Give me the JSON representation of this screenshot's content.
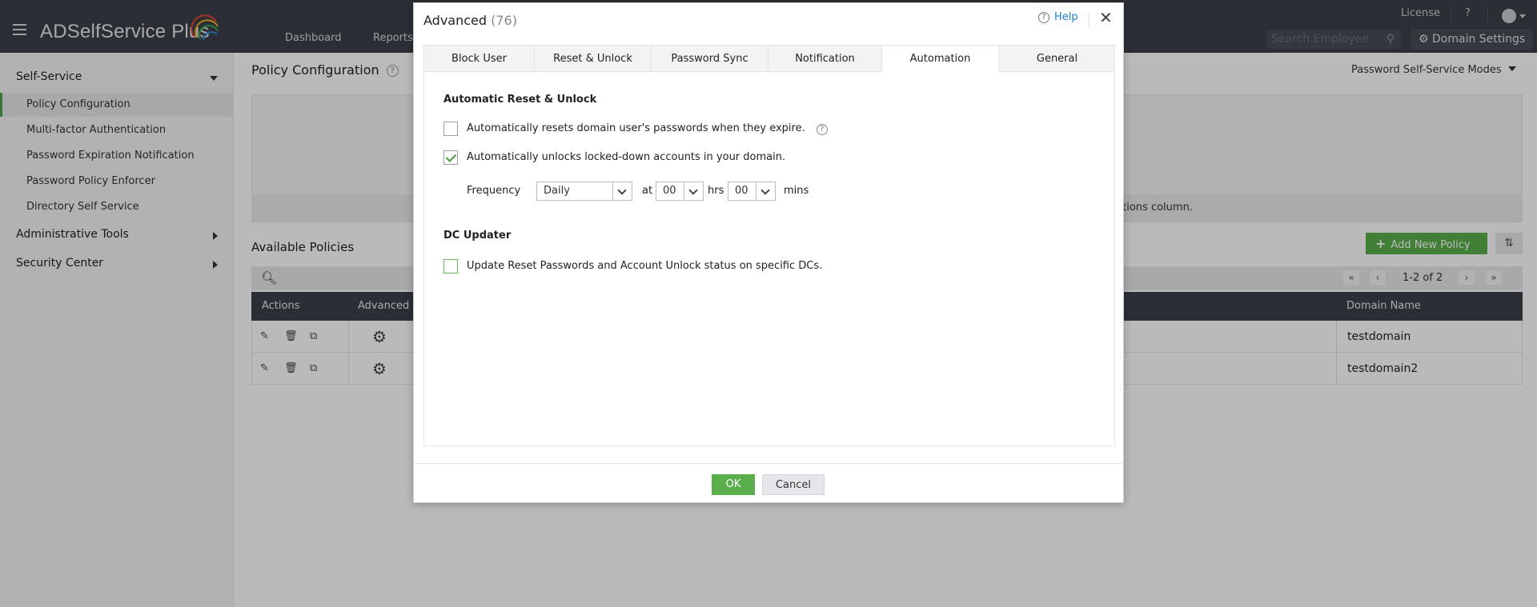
{
  "app": {
    "logo_text": "ADSelfService Plus",
    "nav": [
      "Dashboard",
      "Reports"
    ],
    "license_link": "License",
    "help_link": "?",
    "search_placeholder": "Search Employee",
    "domain_settings_label": "Domain Settings"
  },
  "sidebar": {
    "sections": [
      {
        "label": "Self-Service",
        "expanded": true
      },
      {
        "label": "Administrative Tools",
        "expanded": false
      },
      {
        "label": "Security Center",
        "expanded": false
      }
    ],
    "items": [
      {
        "label": "Policy Configuration",
        "active": true
      },
      {
        "label": "Multi-factor Authentication",
        "active": false
      },
      {
        "label": "Password Expiration Notification",
        "active": false
      },
      {
        "label": "Password Policy Enforcer",
        "active": false
      },
      {
        "label": "Directory Self Service",
        "active": false
      }
    ]
  },
  "main": {
    "title": "Policy Configuration",
    "modes_label": "Password Self-Service Modes",
    "strip_text": "ctions column.",
    "available_policies_title": "Available Policies",
    "add_policy_label": "Add New Policy",
    "pager_text": "1-2 of 2",
    "table": {
      "headers": [
        "Actions",
        "Advanced",
        "Domain Name"
      ],
      "rows": [
        {
          "domain": "testdomain"
        },
        {
          "domain": "testdomain2"
        }
      ]
    }
  },
  "modal": {
    "title": "Advanced",
    "count": "(76)",
    "help_label": "Help",
    "tabs": [
      {
        "label": "Block User",
        "active": false
      },
      {
        "label": "Reset & Unlock",
        "active": false
      },
      {
        "label": "Password Sync",
        "active": false
      },
      {
        "label": "Notification",
        "active": false
      },
      {
        "label": "Automation",
        "active": true
      },
      {
        "label": "General",
        "active": false
      }
    ],
    "auto_section_title": "Automatic Reset & Unlock",
    "opt_reset_label": "Automatically resets domain user's passwords when they expire.",
    "opt_reset_checked": false,
    "opt_unlock_label": "Automatically unlocks locked-down accounts in your domain.",
    "opt_unlock_checked": true,
    "frequency_label": "Frequency",
    "frequency_value": "Daily",
    "at_label": "at",
    "hrs_value": "00",
    "hrs_label": "hrs",
    "mins_value": "00",
    "mins_label": "mins",
    "dc_section_title": "DC Updater",
    "opt_dc_label": "Update Reset Passwords and Account Unlock status on specific DCs.",
    "opt_dc_checked": false,
    "ok_label": "OK",
    "cancel_label": "Cancel"
  },
  "colors": {
    "topbar": "#3b4149",
    "accent_green": "#5aae4b",
    "link_blue": "#1a7fc4"
  }
}
